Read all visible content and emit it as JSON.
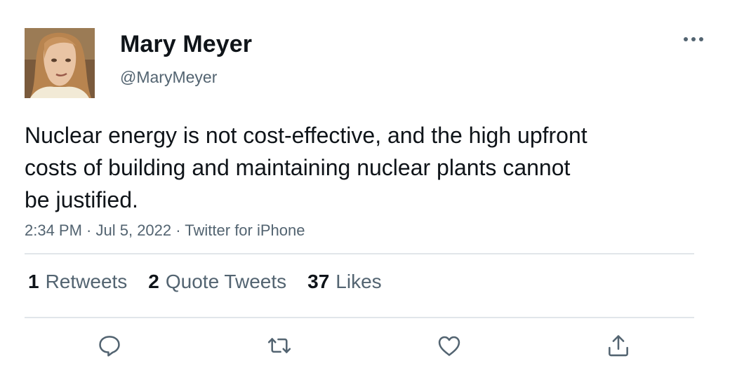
{
  "author": {
    "name": "Mary Meyer",
    "handle": "@MaryMeyer"
  },
  "tweet": {
    "text": "Nuclear energy is not cost-effective, and the high upfront costs of building and maintaining nuclear plants cannot be justified.",
    "time": "2:34 PM",
    "date": "Jul 5, 2022",
    "source": "Twitter for iPhone",
    "separator": " · "
  },
  "stats": {
    "retweets_count": "1",
    "retweets_label": "Retweets",
    "quotes_count": "2",
    "quotes_label": "Quote Tweets",
    "likes_count": "37",
    "likes_label": "Likes"
  },
  "icons": {
    "more": "more-horizontal-icon",
    "reply": "reply-icon",
    "retweet": "retweet-icon",
    "like": "heart-icon",
    "share": "share-icon"
  },
  "colors": {
    "text_primary": "#0f1419",
    "text_secondary": "#536471",
    "divider": "#e1e6ea",
    "icon": "#536471"
  }
}
